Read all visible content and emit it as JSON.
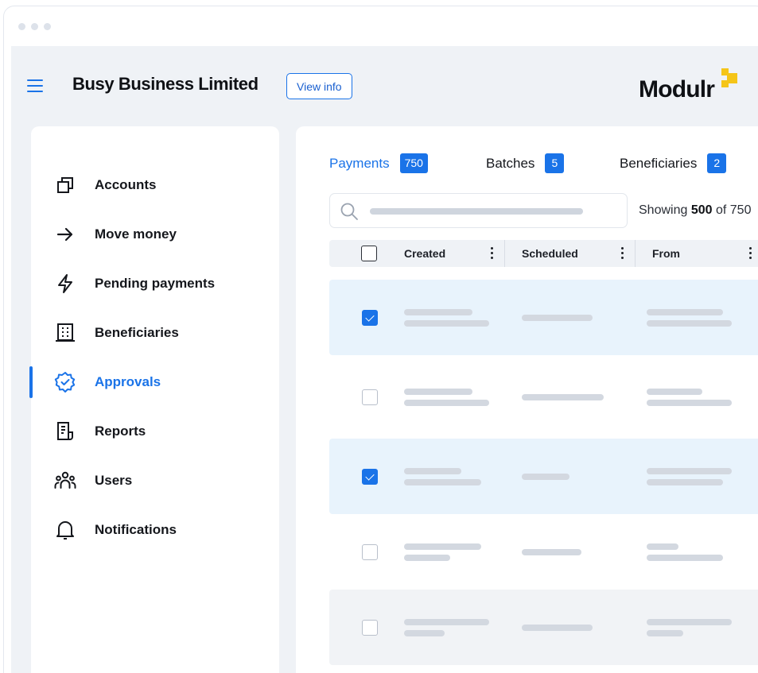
{
  "header": {
    "company_name": "Busy Business Limited",
    "view_info_label": "View info",
    "logo_text": "Modulr"
  },
  "sidebar": {
    "items": [
      {
        "label": "Accounts",
        "icon": "accounts-icon"
      },
      {
        "label": "Move money",
        "icon": "arrow-right-icon"
      },
      {
        "label": "Pending payments",
        "icon": "lightning-icon"
      },
      {
        "label": "Beneficiaries",
        "icon": "building-icon"
      },
      {
        "label": "Approvals",
        "icon": "verified-badge-icon",
        "active": true
      },
      {
        "label": "Reports",
        "icon": "report-icon"
      },
      {
        "label": "Users",
        "icon": "users-icon"
      },
      {
        "label": "Notifications",
        "icon": "bell-icon"
      }
    ]
  },
  "tabs": [
    {
      "label": "Payments",
      "count": "750",
      "active": true
    },
    {
      "label": "Batches",
      "count": "5"
    },
    {
      "label": "Beneficiaries",
      "count": "2"
    }
  ],
  "search": {
    "placeholder": ""
  },
  "showing": {
    "prefix": "Showing",
    "count": "500",
    "of": "of",
    "total": "750"
  },
  "table": {
    "columns": [
      "Created",
      "Scheduled",
      "From"
    ],
    "rows": [
      {
        "selected": true
      },
      {
        "selected": false
      },
      {
        "selected": true
      },
      {
        "selected": false
      },
      {
        "selected": false
      }
    ]
  },
  "colors": {
    "accent": "#1a73e8",
    "logo_yellow": "#f5c518",
    "selected_row": "#e8f3fc",
    "app_background": "#eff2f6"
  }
}
